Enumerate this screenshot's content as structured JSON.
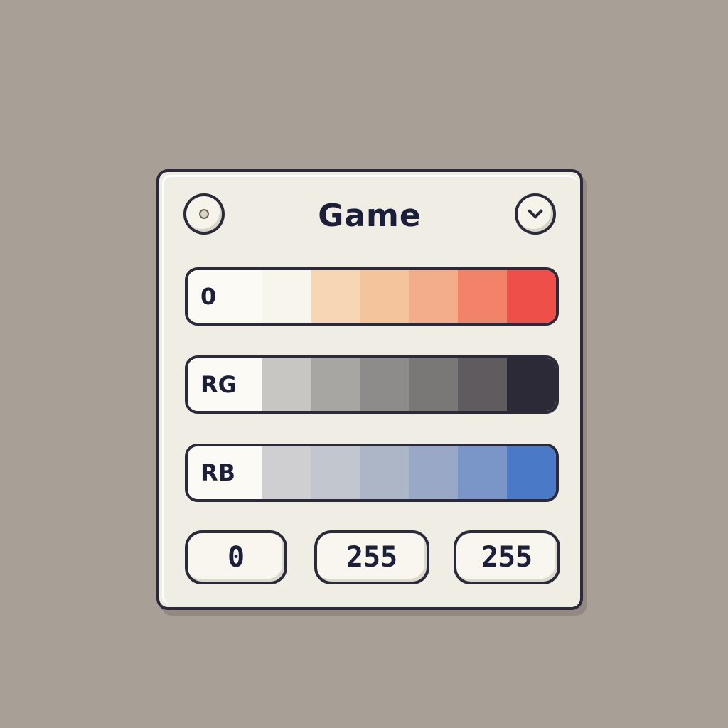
{
  "panel": {
    "title": "Game",
    "left_button_icon": "dot-icon",
    "right_button_icon": "chevron-down-icon"
  },
  "bars": [
    {
      "label": "0",
      "swatches": [
        "#f8f5ec",
        "#f6d6b4",
        "#f4c49c",
        "#f3ad8a",
        "#f28268",
        "#ee5049"
      ]
    },
    {
      "label": "RG",
      "swatches": [
        "#c8c6c2",
        "#a8a6a3",
        "#8e8c8b",
        "#7a7777",
        "#605b5e",
        "#2c2a37"
      ]
    },
    {
      "label": "RB",
      "swatches": [
        "#cfcfd1",
        "#c2c6cf",
        "#adb6c6",
        "#98a8c6",
        "#7a96c8",
        "#4a79c8"
      ]
    }
  ],
  "values": [
    "0",
    "255",
    "255"
  ]
}
